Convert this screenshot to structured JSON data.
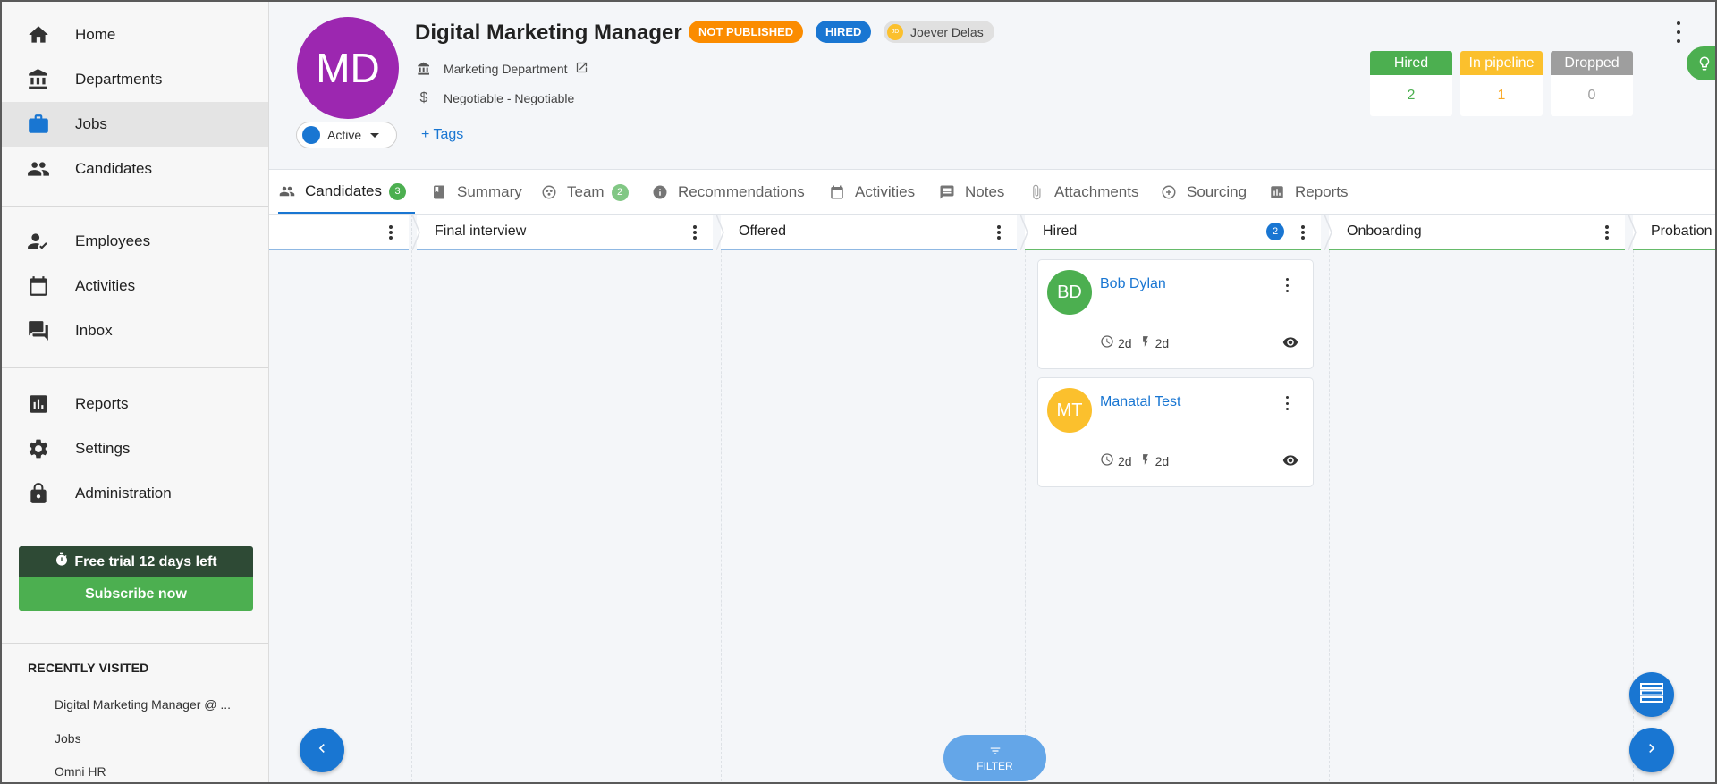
{
  "sidebar": {
    "nav": [
      {
        "label": "Home",
        "icon": "home-icon"
      },
      {
        "label": "Departments",
        "icon": "bank-icon"
      },
      {
        "label": "Jobs",
        "icon": "briefcase-icon",
        "active": true
      },
      {
        "label": "Candidates",
        "icon": "people-icon"
      },
      {
        "label": "Employees",
        "icon": "person-check-icon"
      },
      {
        "label": "Activities",
        "icon": "calendar-icon"
      },
      {
        "label": "Inbox",
        "icon": "forum-icon"
      },
      {
        "label": "Reports",
        "icon": "bar-chart-icon"
      },
      {
        "label": "Settings",
        "icon": "gear-icon"
      },
      {
        "label": "Administration",
        "icon": "lock-icon"
      }
    ],
    "trial": {
      "text": "Free trial 12 days left",
      "button": "Subscribe now"
    },
    "recent": {
      "title": "RECENTLY VISITED",
      "items": [
        "Digital Marketing Manager @ ...",
        "Jobs",
        "Omni HR"
      ]
    }
  },
  "job": {
    "initials": "MD",
    "title": "Digital Marketing Manager",
    "badge_not_published": "NOT PUBLISHED",
    "badge_hired": "HIRED",
    "owner_initials": "JD",
    "owner": "Joever Delas",
    "department": "Marketing Department",
    "salary": "Negotiable - Negotiable",
    "status": "Active",
    "tags_label": "+ Tags"
  },
  "stats": [
    {
      "label": "Hired",
      "value": "2",
      "color": "#4caf50"
    },
    {
      "label": "In pipeline",
      "value": "1",
      "color": "#fbc02d"
    },
    {
      "label": "Dropped",
      "value": "0",
      "color": "#9e9e9e"
    }
  ],
  "tabs": [
    {
      "label": "Candidates",
      "count": "3",
      "icon": "people-icon"
    },
    {
      "label": "Summary",
      "icon": "book-icon"
    },
    {
      "label": "Team",
      "count": "2",
      "icon": "team-icon"
    },
    {
      "label": "Recommendations",
      "icon": "info-icon"
    },
    {
      "label": "Activities",
      "icon": "calendar-icon"
    },
    {
      "label": "Notes",
      "icon": "note-icon"
    },
    {
      "label": "Attachments",
      "icon": "paperclip-icon"
    },
    {
      "label": "Sourcing",
      "icon": "sourcing-icon"
    },
    {
      "label": "Reports",
      "icon": "report-icon"
    }
  ],
  "columns": [
    {
      "title": ""
    },
    {
      "title": "Final interview"
    },
    {
      "title": "Offered"
    },
    {
      "title": "Hired",
      "count": "2"
    },
    {
      "title": "Onboarding"
    },
    {
      "title": "Probation"
    }
  ],
  "cards": [
    {
      "initials": "BD",
      "name": "Bob Dylan",
      "time_in_stage": "2d",
      "last_activity": "2d",
      "color": "#4caf50"
    },
    {
      "initials": "MT",
      "name": "Manatal Test",
      "time_in_stage": "2d",
      "last_activity": "2d",
      "color": "#fbc02d"
    }
  ],
  "filter": {
    "label": "FILTER"
  }
}
